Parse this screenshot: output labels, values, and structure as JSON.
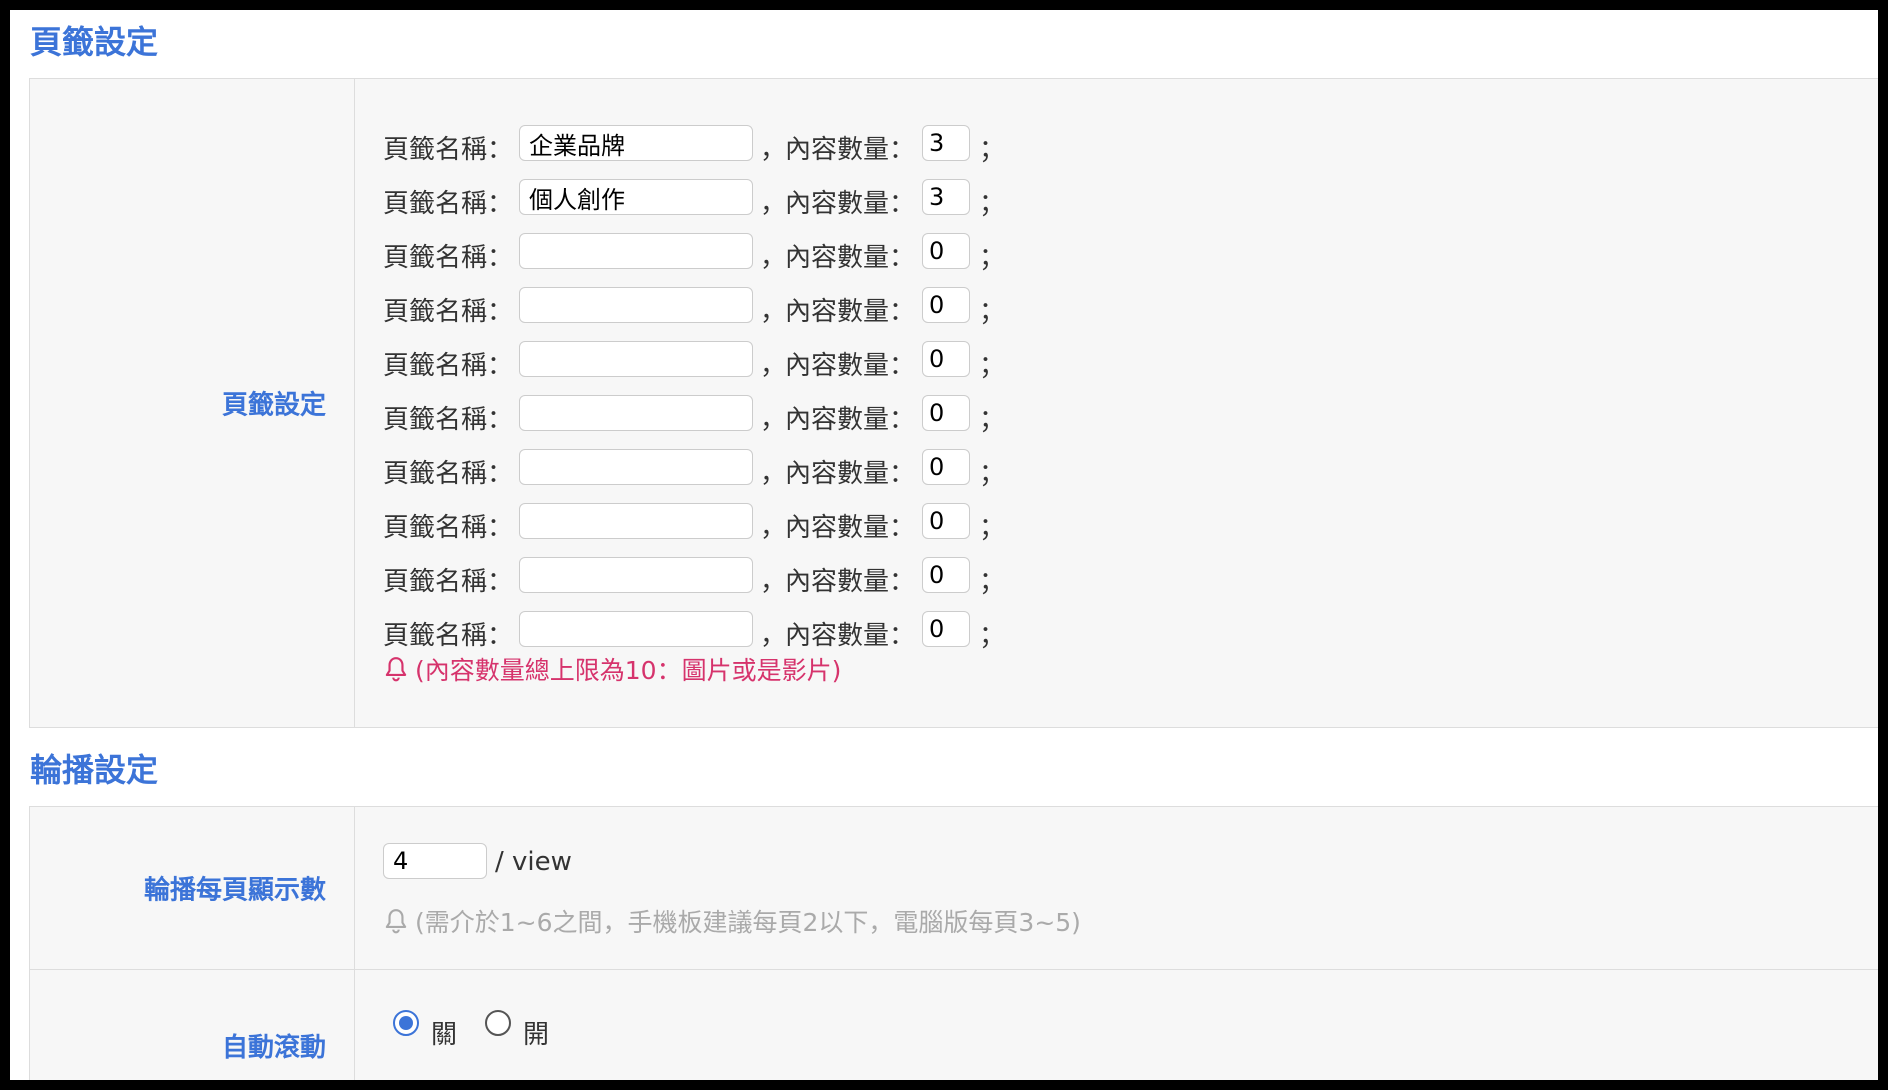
{
  "tabs_section": {
    "title": "頁籤設定",
    "label": "頁籤設定",
    "name_label": "頁籤名稱：",
    "comma": "，",
    "qty_label": "內容數量：",
    "semicolon": "；",
    "rows": [
      {
        "name": "企業品牌",
        "qty": "3"
      },
      {
        "name": "個人創作",
        "qty": "3"
      },
      {
        "name": "",
        "qty": "0"
      },
      {
        "name": "",
        "qty": "0"
      },
      {
        "name": "",
        "qty": "0"
      },
      {
        "name": "",
        "qty": "0"
      },
      {
        "name": "",
        "qty": "0"
      },
      {
        "name": "",
        "qty": "0"
      },
      {
        "name": "",
        "qty": "0"
      },
      {
        "name": "",
        "qty": "0"
      }
    ],
    "note": "(內容數量總上限為10：圖片或是影片)",
    "note_color": "#d6336c"
  },
  "carousel_section": {
    "title": "輪播設定",
    "per_view": {
      "label": "輪播每頁顯示數",
      "value": "4",
      "unit": "/ view",
      "note": "(需介於1~6之間，手機板建議每頁2以下，電腦版每頁3~5)"
    },
    "auto_scroll": {
      "label": "自動滾動",
      "options": [
        {
          "label": "關",
          "selected": true
        },
        {
          "label": "開",
          "selected": false
        }
      ]
    }
  },
  "colors": {
    "accent": "#3c74d8",
    "panel_bg": "#f7f7f7"
  },
  "icons": {
    "note_icon": "bell-icon"
  }
}
